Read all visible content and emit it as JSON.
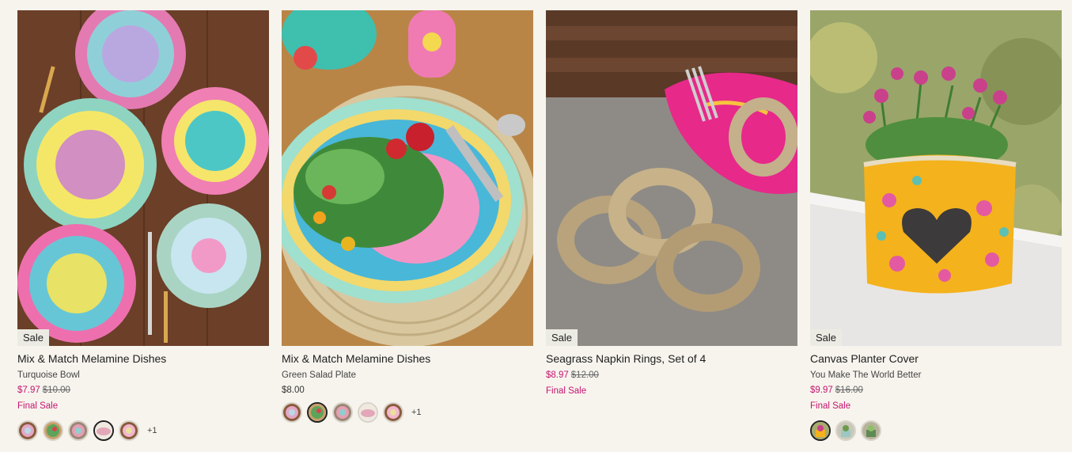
{
  "products": [
    {
      "badge": "Sale",
      "title": "Mix & Match Melamine Dishes",
      "variant": "Turquoise Bowl",
      "price_sale": "$7.97",
      "price_orig": "$10.00",
      "final": "Final Sale",
      "swatch_more": "+1"
    },
    {
      "title": "Mix & Match Melamine Dishes",
      "variant": "Green Salad Plate",
      "price": "$8.00",
      "swatch_more": "+1"
    },
    {
      "badge": "Sale",
      "title": "Seagrass Napkin Rings, Set of 4",
      "price_sale": "$8.97",
      "price_orig": "$12.00",
      "final": "Final Sale"
    },
    {
      "badge": "Sale",
      "title": "Canvas Planter Cover",
      "variant": "You Make The World Better",
      "price_sale": "$9.97",
      "price_orig": "$16.00",
      "final": "Final Sale"
    }
  ],
  "colors": {
    "sale_price": "#c4156f",
    "background": "#f7f4ee",
    "badge_bg": "#ecebe3"
  }
}
